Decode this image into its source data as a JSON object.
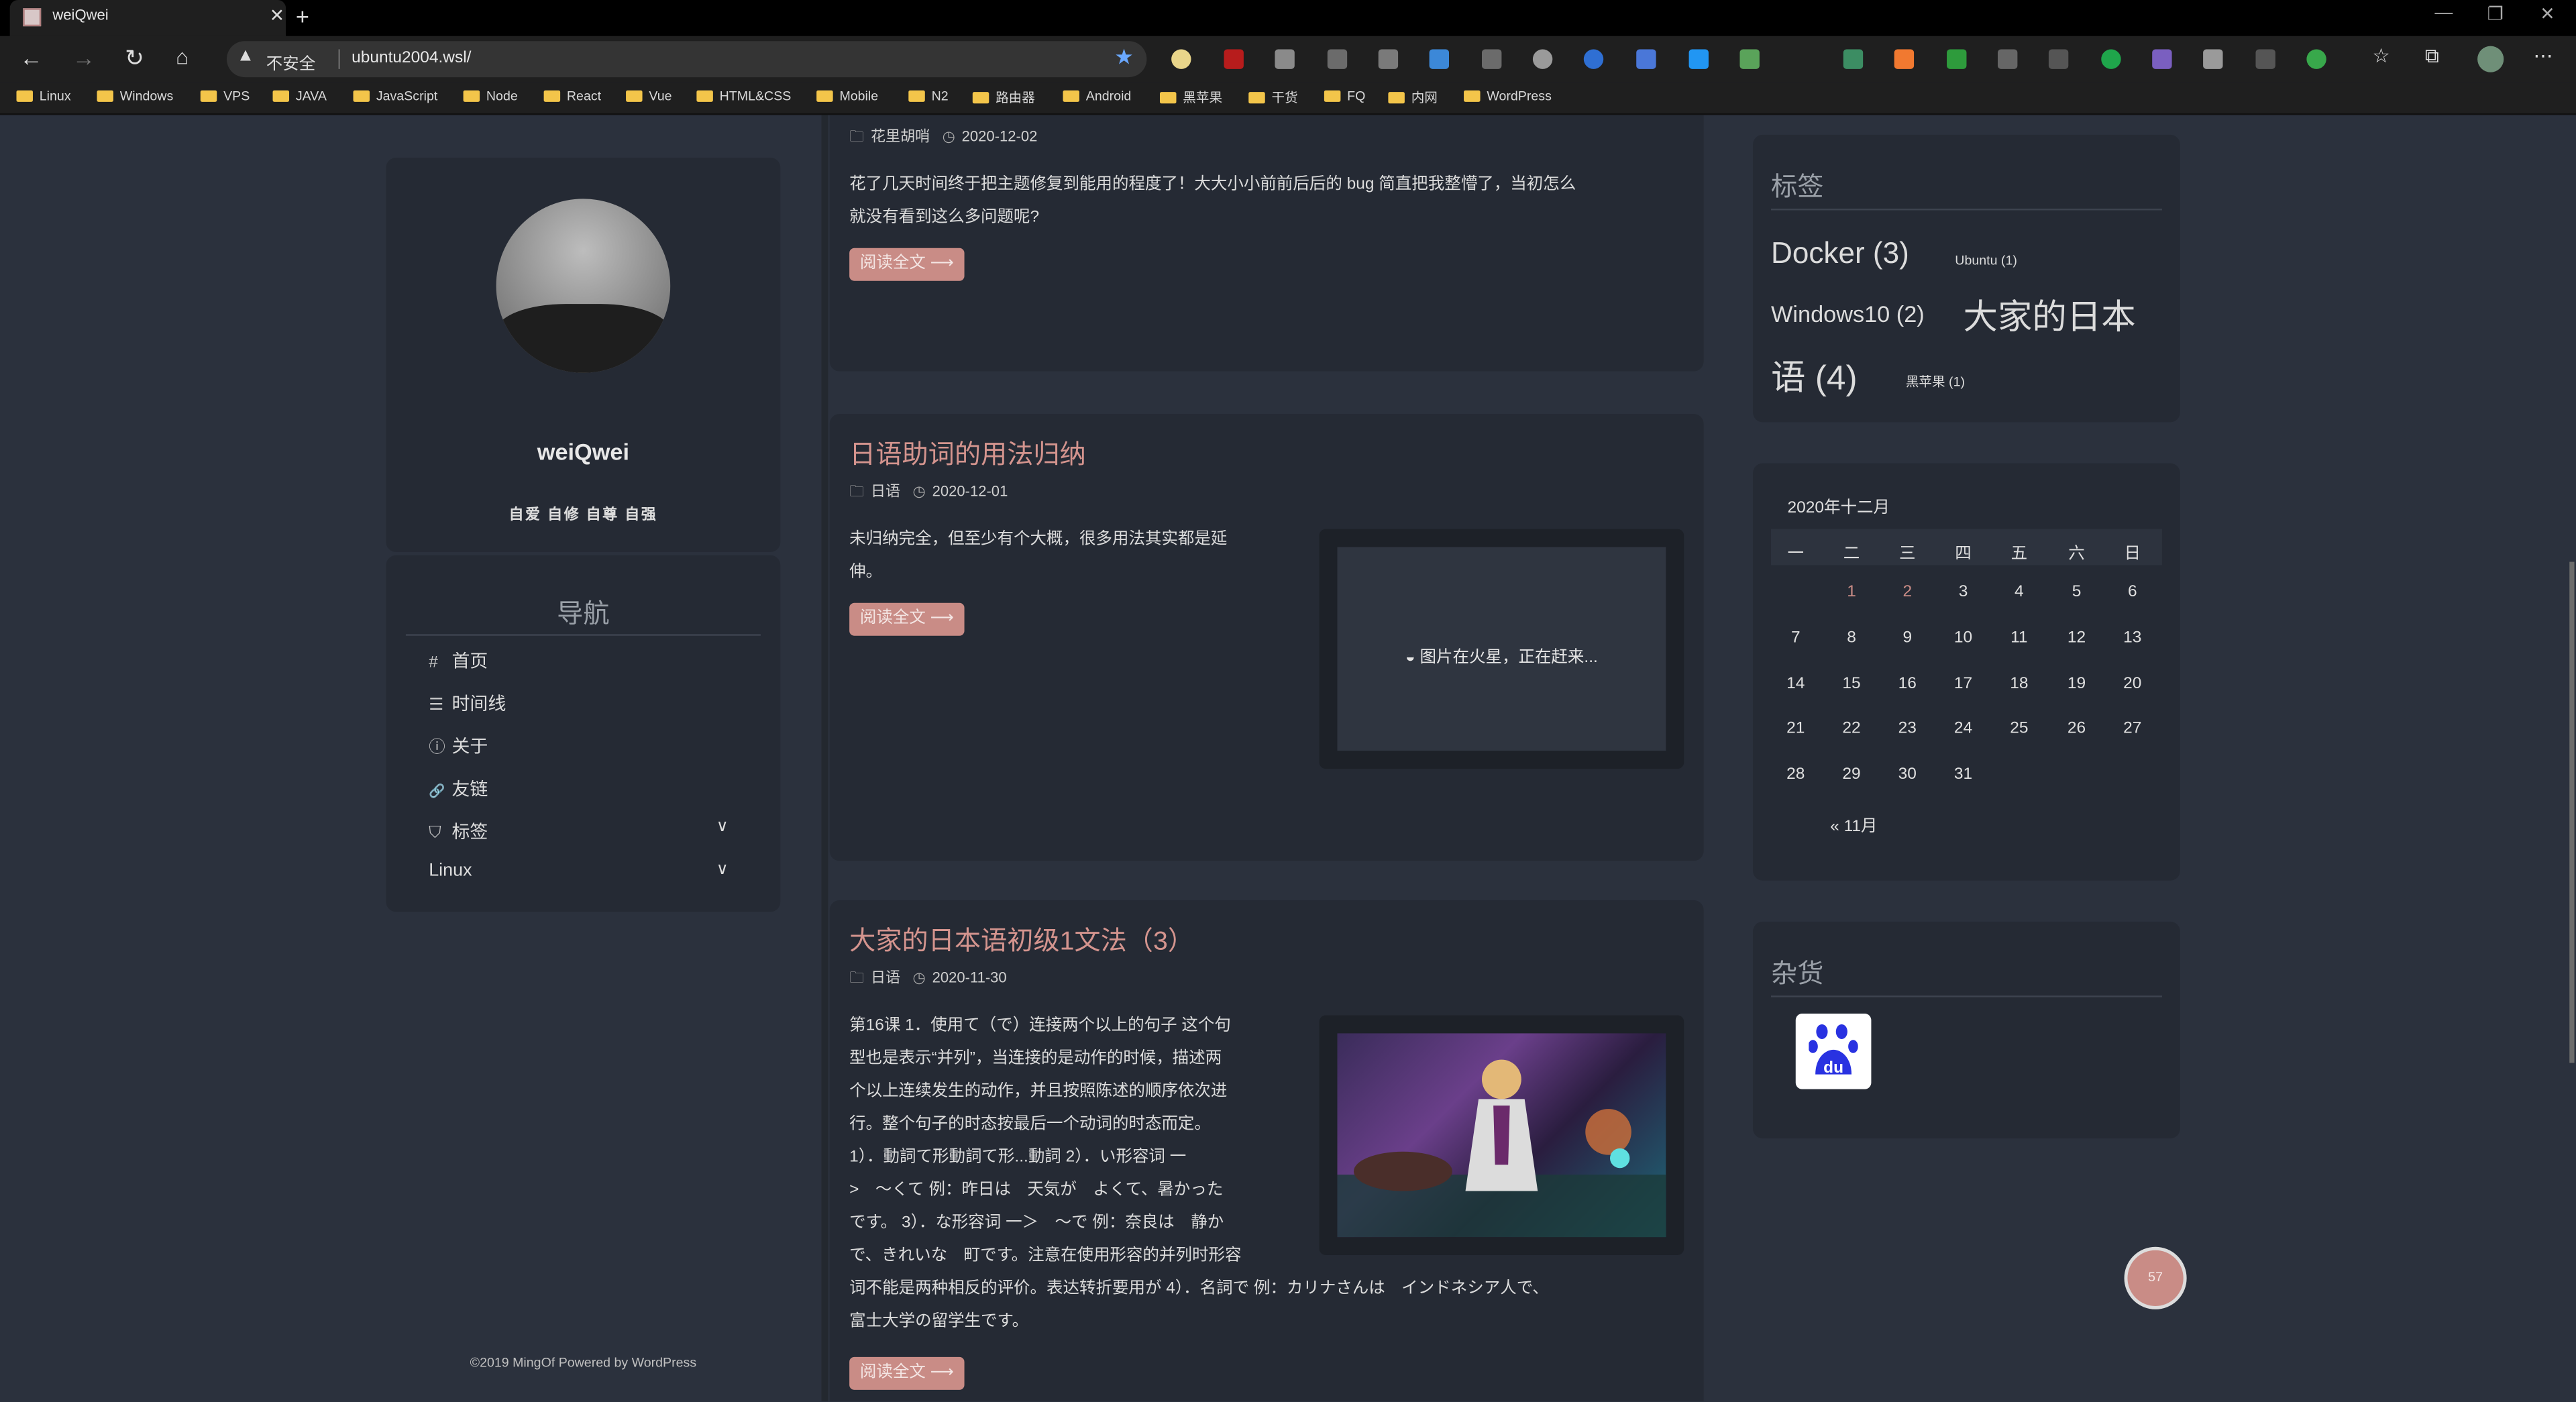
{
  "browser": {
    "tab_title": "weiQwei",
    "new_tab": "+",
    "not_secure": "不安全",
    "url": "ubuntu2004.wsl/",
    "window_controls": [
      "—",
      "❐",
      "✕"
    ],
    "bookmarks": [
      "Linux",
      "Windows",
      "VPS",
      "JAVA",
      "JavaScript",
      "Node",
      "React",
      "Vue",
      "HTML&CSS",
      "Mobile",
      "N2",
      "路由器",
      "Android",
      "黑苹果",
      "干货",
      "FQ",
      "内网",
      "WordPress"
    ]
  },
  "profile": {
    "name": "weiQwei",
    "motto": "自爱 自修 自尊 自强"
  },
  "nav": {
    "title": "导航",
    "items": [
      {
        "icon": "#",
        "label": "首页"
      },
      {
        "icon": "☰",
        "label": "时间线"
      },
      {
        "icon": "ⓘ",
        "label": "关于"
      },
      {
        "icon": "🔗",
        "label": "友链"
      },
      {
        "icon": "⛉",
        "label": "标签"
      },
      {
        "icon": "",
        "label": "Linux"
      }
    ]
  },
  "footer": "©2019 MingOf Powered by WordPress",
  "posts": [
    {
      "category": "花里胡哨",
      "date": "2020-12-02",
      "excerpt_lines": [
        "花了几天时间终于把主题修复到能用的程度了！大大小小前前后后的 bug 简直把我整懵了，当初怎么",
        "就没有看到这么多问题呢?"
      ],
      "read_more": "阅读全文 ⟶"
    },
    {
      "title": "日语助词的用法归纳",
      "category": "日语",
      "date": "2020-12-01",
      "excerpt_lines": [
        "未归纳完全，但至少有个大概，很多用法其实都是延",
        "伸。"
      ],
      "read_more": "阅读全文 ⟶",
      "image_placeholder": "图片在火星，正在赶来..."
    },
    {
      "title": "大家的日本语初级1文法（3）",
      "category": "日语",
      "date": "2020-11-30",
      "excerpt_lines": [
        "第16课 1．使用て（で）连接两个以上的句子 这个句",
        "型也是表示“并列”，当连接的是动作的时候，描述两",
        "个以上连续发生的动作，并且按照陈述的顺序依次进",
        "行。整个句子的时态按最后一个动词的时态而定。",
        "1）．動詞て形動詞て形...動詞 2）．い形容词 一",
        ">　～くて 例：昨日は　天気が　よくて、暑かった",
        "です。 3）．な形容词 一＞　～で 例：奈良は　静か",
        "で、きれいな　町です。注意在使用形容的并列时形容",
        "词不能是两种相反的评价。表达转折要用が 4）．名詞で 例：カリナさんは　インドネシア人で、",
        "富士大学の留学生です。"
      ],
      "read_more": "阅读全文 ⟶"
    }
  ],
  "tags_widget": {
    "title": "标签",
    "tags": [
      {
        "label": "Docker (3)"
      },
      {
        "label": "Ubuntu (1)"
      },
      {
        "label": "Windows10 (2)"
      },
      {
        "label": "大家的日本"
      },
      {
        "label": "语 (4)"
      },
      {
        "label": "黑苹果 (1)"
      }
    ]
  },
  "calendar": {
    "caption": "2020年十二月",
    "weekdays": [
      "一",
      "二",
      "三",
      "四",
      "五",
      "六",
      "日"
    ],
    "weeks": [
      [
        "",
        "1",
        "2",
        "3",
        "4",
        "5",
        "6"
      ],
      [
        "7",
        "8",
        "9",
        "10",
        "11",
        "12",
        "13"
      ],
      [
        "14",
        "15",
        "16",
        "17",
        "18",
        "19",
        "20"
      ],
      [
        "21",
        "22",
        "23",
        "24",
        "25",
        "26",
        "27"
      ],
      [
        "28",
        "29",
        "30",
        "31",
        "",
        "",
        ""
      ]
    ],
    "linked_days": [
      "1",
      "2"
    ],
    "prev": "« 11月"
  },
  "misc_widget": {
    "title": "杂货"
  },
  "back_to_top": "57",
  "colors": {
    "accent": "#c98c86",
    "background": "#2b313d",
    "card": "#252a34"
  }
}
